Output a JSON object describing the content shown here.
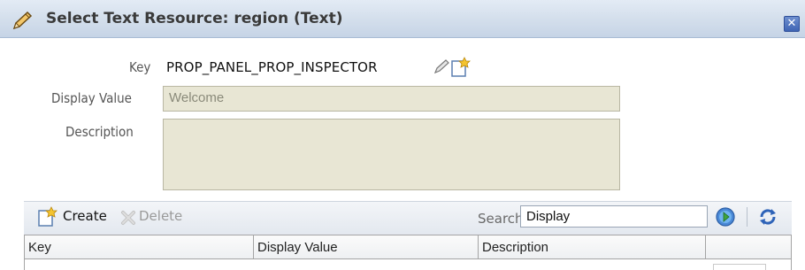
{
  "dialog": {
    "title": "Select Text Resource: region (Text)",
    "close_symbol": "✕"
  },
  "form": {
    "key_label": "Key",
    "key_value": "PROP_PANEL_PROP_INSPECTOR",
    "display_value_label": "Display Value",
    "display_value": "Welcome",
    "description_label": "Description",
    "description_value": ""
  },
  "toolbar": {
    "create_label": "Create",
    "delete_label": "Delete",
    "search_label": "Search",
    "search_value": "Display"
  },
  "table": {
    "columns": [
      "Key",
      "Display Value",
      "Description"
    ]
  },
  "icons": {
    "edit": "pencil-icon",
    "new": "new-document-icon",
    "delete": "delete-x-icon",
    "go": "go-arrow-icon",
    "refresh": "refresh-icon",
    "close": "close-icon"
  },
  "colors": {
    "titlebar": "#d4dfec",
    "readonly_field": "#e8e6d4",
    "close_button": "#3f64b4"
  }
}
